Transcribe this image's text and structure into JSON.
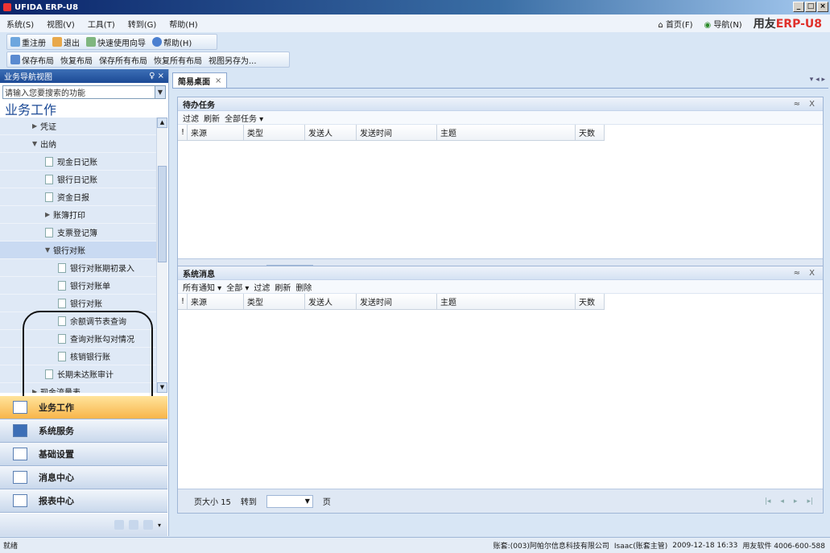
{
  "window": {
    "title": "UFIDA ERP-U8"
  },
  "menu": {
    "items": [
      "系统(S)",
      "视图(V)",
      "工具(T)",
      "转到(G)",
      "帮助(H)"
    ],
    "home": "首页(F)",
    "nav": "导航(N)",
    "brand_prefix": "用友",
    "brand_erp": "ERP-",
    "brand_suffix": "U8"
  },
  "toolbar1": {
    "relogin": "重注册",
    "logout": "退出",
    "quickguide": "快速使用向导",
    "help": "帮助(H)"
  },
  "toolbar2": {
    "save_layout": "保存布局",
    "restore_layout": "恢复布局",
    "save_all": "保存所有布局",
    "restore_all": "恢复所有布局",
    "save_as": "视图另存为..."
  },
  "sidebar": {
    "header": "业务导航视图",
    "pin": "♀ ×",
    "search_placeholder": "请输入您要搜索的功能",
    "title": "业务工作",
    "tree": [
      {
        "label": "凭证",
        "level": 1,
        "type": "collapsed"
      },
      {
        "label": "出纳",
        "level": 1,
        "type": "expanded"
      },
      {
        "label": "现金日记账",
        "level": 2,
        "type": "doc"
      },
      {
        "label": "银行日记账",
        "level": 2,
        "type": "doc"
      },
      {
        "label": "资金日报",
        "level": 2,
        "type": "doc"
      },
      {
        "label": "账簿打印",
        "level": 2,
        "type": "collapsed"
      },
      {
        "label": "支票登记簿",
        "level": 2,
        "type": "doc"
      },
      {
        "label": "银行对账",
        "level": 2,
        "type": "expanded"
      },
      {
        "label": "银行对账期初录入",
        "level": 3,
        "type": "doc"
      },
      {
        "label": "银行对账单",
        "level": 3,
        "type": "doc"
      },
      {
        "label": "银行对账",
        "level": 3,
        "type": "doc"
      },
      {
        "label": "余额调节表查询",
        "level": 3,
        "type": "doc"
      },
      {
        "label": "查询对账勾对情况",
        "level": 3,
        "type": "doc"
      },
      {
        "label": "核销银行账",
        "level": 3,
        "type": "doc"
      },
      {
        "label": "长期未达账审计",
        "level": 2,
        "type": "doc"
      },
      {
        "label": "现金流量表",
        "level": 1,
        "type": "collapsed"
      }
    ],
    "nav_buttons": [
      "业务工作",
      "系统服务",
      "基础设置",
      "消息中心",
      "报表中心"
    ]
  },
  "main": {
    "tab_label": "简易桌面",
    "tab_close": "×",
    "tab_controls": "▾ ◂ ▸",
    "panel_controls": "≈ X",
    "todo": {
      "title": "待办任务",
      "tools": [
        "过滤",
        "刷新",
        "全部任务 ▾"
      ]
    },
    "messages": {
      "title": "系统消息",
      "tools": [
        "所有通知 ▾",
        "全部 ▾",
        "过滤",
        "刷新",
        "删除"
      ]
    },
    "columns": [
      "!",
      "来源",
      "类型",
      "发送人",
      "发送时间",
      "主题",
      "天数"
    ],
    "pager": {
      "page_size_label": "页大小",
      "page_size": "15",
      "goto_label": "转到",
      "page_label": "页",
      "nav": [
        "|◂",
        "◂",
        "▸",
        "▸|"
      ]
    }
  },
  "status": {
    "left": "就绪",
    "account": "账套:(003)阿帕尔信息科技有限公司",
    "operator": "Isaac(账套主管)",
    "date": "2009-12-18 16:33",
    "company": "用友软件 4006-600-588"
  }
}
